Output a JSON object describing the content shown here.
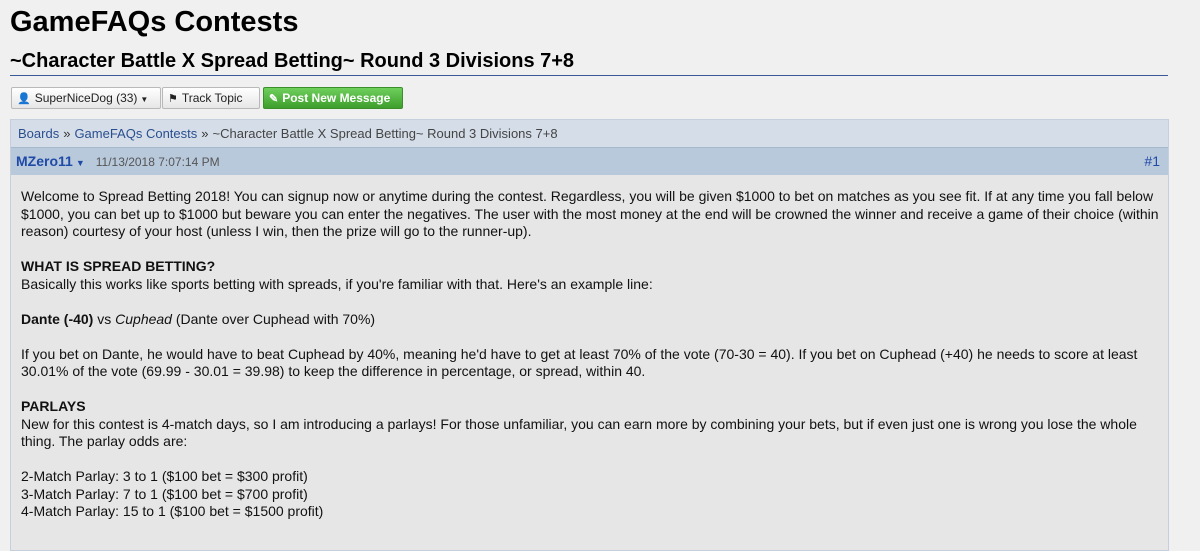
{
  "board_title": "GameFAQs Contests",
  "topic_title": "~Character Battle X Spread Betting~ Round 3 Divisions 7+8",
  "toolbar": {
    "user_label": "SuperNiceDog (33)",
    "track_label": "Track Topic",
    "post_label": "Post New Message"
  },
  "breadcrumb": {
    "boards": "Boards",
    "sep": "»",
    "board": "GameFAQs Contests",
    "topic": "~Character Battle X Spread Betting~ Round 3 Divisions 7+8"
  },
  "message": {
    "user": "MZero11",
    "timestamp": "11/13/2018 7:07:14 PM",
    "number": "#1",
    "intro": "Welcome to Spread Betting 2018! You can signup now or anytime during the contest. Regardless, you will be given $1000 to bet on matches as you see fit. If at any time you fall below $1000, you can bet up to $1000 but beware you can enter the negatives. The user with the most money at the end will be crowned the winner and receive a game of their choice (within reason) courtesy of your host (unless I win, then the prize will go to the runner-up).",
    "heading1": "WHAT IS SPREAD BETTING?",
    "explain": "Basically this works like sports betting with spreads, if you're familiar with that. Here's an example line:",
    "example_fav": "Dante (-40)",
    "example_vs": "vs",
    "example_dog": "Cuphead",
    "example_note": "(Dante over Cuphead with 70%)",
    "example_explain": "If you bet on Dante, he would have to beat Cuphead by 40%, meaning he'd have to get at least 70% of the vote (70-30 = 40). If you bet on Cuphead (+40) he needs to score at least 30.01% of the vote (69.99 - 30.01 = 39.98) to keep the difference in percentage, or spread, within 40.",
    "heading2": "PARLAYS",
    "parlay_intro": "New for this contest is 4-match days, so I am introducing a parlays! For those unfamiliar, you can earn more by combining your bets, but if even just one is wrong you lose the whole thing. The parlay odds are:",
    "parlays": [
      "2-Match Parlay: 3 to 1 ($100 bet = $300 profit)",
      "3-Match Parlay: 7 to 1 ($100 bet = $700 profit)",
      "4-Match Parlay: 15 to 1 ($100 bet = $1500 profit)"
    ]
  }
}
